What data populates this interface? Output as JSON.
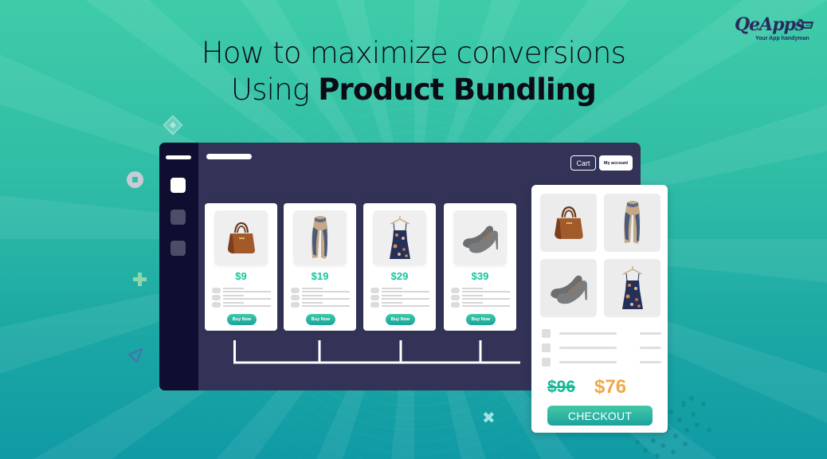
{
  "headline": {
    "line1": "How to maximize conversions",
    "line2_prefix": "Using ",
    "line2_strong": "Product Bundling"
  },
  "logo": {
    "name": "QeApps",
    "tagline": "Your App handyman"
  },
  "dashboard": {
    "cart_label": "Cart",
    "account_label": "My account",
    "products": [
      {
        "name": "handbag",
        "icon": "handbag-icon",
        "price": "$9",
        "button": "Buy Now"
      },
      {
        "name": "scarf",
        "icon": "scarf-icon",
        "price": "$19",
        "button": "Buy Now"
      },
      {
        "name": "dress",
        "icon": "dress-icon",
        "price": "$29",
        "button": "Buy Now"
      },
      {
        "name": "heels",
        "icon": "heels-icon",
        "price": "$39",
        "button": "Buy Now"
      }
    ]
  },
  "bundle": {
    "items": [
      "handbag",
      "scarf",
      "heels",
      "dress"
    ],
    "original_price": "$96",
    "bundle_price": "$76",
    "checkout_label": "CHECKOUT"
  },
  "colors": {
    "accent_green": "#16c39a",
    "bundle_price": "#f0a847",
    "window_bg": "#333358",
    "sidebar_bg": "#0f0e30"
  }
}
